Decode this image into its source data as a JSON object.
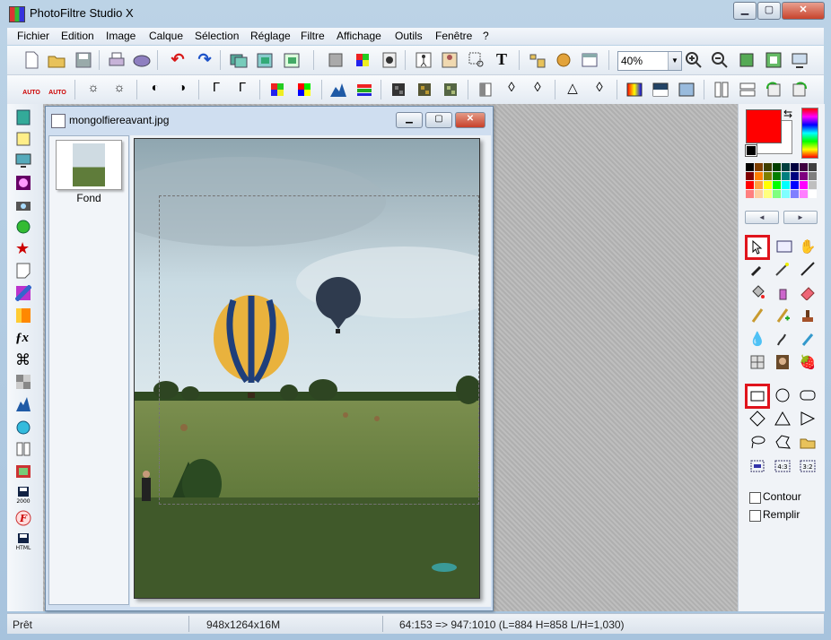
{
  "window": {
    "title": "PhotoFiltre Studio X",
    "controls": {
      "minimize": "▁",
      "maximize": "▢",
      "close": "✕"
    }
  },
  "menu": [
    "Fichier",
    "Edition",
    "Image",
    "Calque",
    "Sélection",
    "Réglage",
    "Filtre",
    "Affichage",
    "Outils",
    "Fenêtre",
    "?"
  ],
  "toolbar1": {
    "zoom_value": "40%",
    "text_tool_label": "T"
  },
  "toolbar2": {
    "auto_contrast_label": "AUTO",
    "auto_levels_label": "AUTO"
  },
  "document": {
    "title": "mongolfiereavant.jpg",
    "controls": {
      "minimize": "▁",
      "maximize": "▢",
      "close": "✕"
    },
    "layer_name": "Fond"
  },
  "colors": {
    "foreground": "#ff0000",
    "background": "#ffffff"
  },
  "palette": [
    "#000000",
    "#7f3f00",
    "#3f3f00",
    "#003f00",
    "#003f3f",
    "#00003f",
    "#3f003f",
    "#3f3f3f",
    "#7f0000",
    "#ff7f00",
    "#7f7f00",
    "#007f00",
    "#007f7f",
    "#00007f",
    "#7f007f",
    "#7f7f7f",
    "#ff0000",
    "#ff9f3f",
    "#ffff00",
    "#00ff00",
    "#00ffff",
    "#0000ff",
    "#ff00ff",
    "#bfbfbf",
    "#ff7f7f",
    "#ffcf9f",
    "#ffff7f",
    "#7fff7f",
    "#7fffff",
    "#7f7fff",
    "#ff7fff",
    "#ffffff"
  ],
  "options": {
    "contour": "Contour",
    "remplir": "Remplir"
  },
  "status": {
    "state": "Prêt",
    "image_info": "948x1264x16M",
    "selection_info": "64:153 => 947:1010 (L=884  H=858  L/H=1,030)"
  }
}
